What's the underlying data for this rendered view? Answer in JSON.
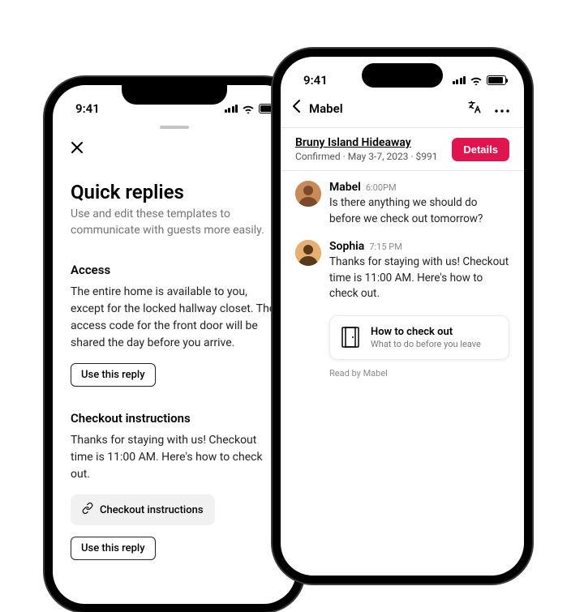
{
  "status_time": "9:41",
  "left": {
    "title": "Quick replies",
    "subtitle": "Use and edit these templates to communicate with guests more easily.",
    "sec1_h": "Access",
    "sec1_body": "The entire home is available to you, except for the locked hallway closet. The access code for the front door will be shared the day before you arrive.",
    "use_reply": "Use this reply",
    "sec2_h": "Checkout instructions",
    "sec2_body": "Thanks for staying with us! Checkout time is 11:00 AM.  Here's how to check out.",
    "chip": "Checkout instructions"
  },
  "right": {
    "nav_title": "Mabel",
    "listing_name": "Bruny Island Hideaway",
    "listing_sub": "Confirmed · May 3-7, 2023 · $991",
    "details_btn": "Details",
    "msg1_name": "Mabel",
    "msg1_time": "6:00PM",
    "msg1_text": "Is there anything we should do before we check out tomorrow?",
    "msg2_name": "Sophia",
    "msg2_time": "7:15 PM",
    "msg2_text": "Thanks for staying with us! Checkout time is 11:00 AM. Here's how to check out.",
    "card_title": "How to check out",
    "card_sub": "What to do before you leave",
    "read": "Read by Mabel"
  }
}
